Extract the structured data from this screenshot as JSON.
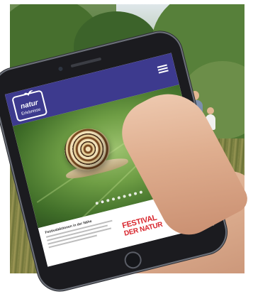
{
  "app": {
    "logo_line1": "natur",
    "logo_line2": "Erlebnisse",
    "menu_icon": "hamburger-menu-icon"
  },
  "hero": {
    "subject": "snail-on-leaf",
    "carousel_total": 9,
    "carousel_active": 1
  },
  "teaser": {
    "title": "Festivalaktionen in der Nähe"
  },
  "festival": {
    "line1": "FESTIVAL",
    "line2": "DER NATUR",
    "accent_color": "#d8262d"
  },
  "colors": {
    "header": "#3d3a8e"
  }
}
